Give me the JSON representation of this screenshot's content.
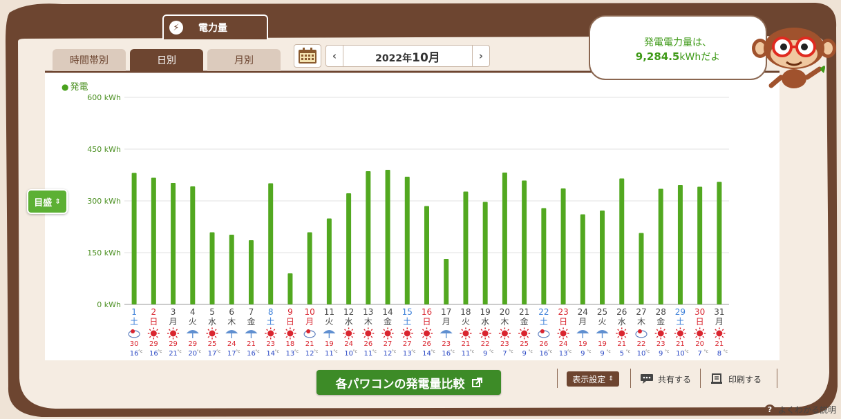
{
  "tabs": {
    "main": "電力量"
  },
  "subtabs": [
    {
      "label": "時間帯別",
      "active": false
    },
    {
      "label": "日別",
      "active": true
    },
    {
      "label": "月別",
      "active": false
    }
  ],
  "date": {
    "year": "2022年",
    "month": "10月",
    "prev": "‹",
    "next": "›"
  },
  "bubble": {
    "line1": "発電電力量は、",
    "value": "9,284.5",
    "unit": "kWh",
    "suffix": "だよ"
  },
  "legend": {
    "label": "発電"
  },
  "mokusei": {
    "label": "目盛",
    "arrows": "⇕"
  },
  "compare_button": {
    "label": "各パワコンの発電量比較",
    "icon": "external-link-icon"
  },
  "toolbar": {
    "display_settings": "表示設定",
    "share": "共有する",
    "print": "印刷する"
  },
  "help": {
    "label": "よくわかる説明"
  },
  "colors": {
    "bar": "#52a820",
    "brown": "#6d4530",
    "saturday": "#3b7fd9",
    "sunday": "#d9252f",
    "temp_high": "#d9252f",
    "temp_low": "#2a48c4"
  },
  "chart_data": {
    "type": "bar",
    "ylim": [
      0,
      600
    ],
    "yticks": [
      "0 kWh",
      "150 kWh",
      "300 kWh",
      "450 kWh",
      "600 kWh"
    ],
    "ytick_values": [
      0,
      150,
      300,
      450,
      600
    ],
    "days": [
      "1",
      "2",
      "3",
      "4",
      "5",
      "6",
      "7",
      "8",
      "9",
      "10",
      "11",
      "12",
      "13",
      "14",
      "15",
      "16",
      "17",
      "18",
      "19",
      "20",
      "21",
      "22",
      "23",
      "24",
      "25",
      "26",
      "27",
      "28",
      "29",
      "30",
      "31"
    ],
    "weekdays": [
      "土",
      "日",
      "月",
      "火",
      "水",
      "木",
      "金",
      "土",
      "日",
      "月",
      "火",
      "水",
      "木",
      "金",
      "土",
      "日",
      "月",
      "火",
      "水",
      "木",
      "金",
      "土",
      "日",
      "月",
      "火",
      "水",
      "木",
      "金",
      "土",
      "日",
      "月"
    ],
    "day_kinds": [
      "sat",
      "sun",
      "wd",
      "wd",
      "wd",
      "wd",
      "wd",
      "sat",
      "sun",
      "hol",
      "wd",
      "wd",
      "wd",
      "wd",
      "sat",
      "sun",
      "wd",
      "wd",
      "wd",
      "wd",
      "wd",
      "sat",
      "sun",
      "wd",
      "wd",
      "wd",
      "wd",
      "wd",
      "sat",
      "sun",
      "wd"
    ],
    "weather": [
      "cloudy",
      "sunny",
      "sunny",
      "rain",
      "sunny",
      "rain",
      "rain",
      "sunny",
      "sunny",
      "cloudy",
      "rain",
      "sunny",
      "sunny",
      "sunny",
      "sunny",
      "sunny",
      "rain",
      "sunny",
      "sunny",
      "sunny",
      "sunny",
      "cloudy",
      "sunny",
      "rain",
      "rain",
      "sunny",
      "cloudy",
      "sunny",
      "sunny",
      "sunny",
      "sunny"
    ],
    "temp_high": [
      "30",
      "29",
      "29",
      "29",
      "25",
      "24",
      "21",
      "23",
      "18",
      "21",
      "19",
      "24",
      "26",
      "27",
      "27",
      "26",
      "23",
      "21",
      "22",
      "23",
      "25",
      "26",
      "24",
      "19",
      "19",
      "21",
      "22",
      "23",
      "21",
      "20",
      "21"
    ],
    "temp_low": [
      "16",
      "16",
      "21",
      "20",
      "17",
      "17",
      "16",
      "14",
      "13",
      "12",
      "11",
      "10",
      "11",
      "12",
      "13",
      "14",
      "16",
      "11",
      "9",
      "7",
      "9",
      "16",
      "13",
      "9",
      "9",
      "5",
      "10",
      "9",
      "10",
      "7",
      "8"
    ],
    "temp_unit": "°c",
    "values": [
      381,
      367,
      352,
      342,
      209,
      202,
      186,
      351,
      90,
      209,
      249,
      322,
      386,
      390,
      370,
      285,
      132,
      327,
      297,
      382,
      359,
      279,
      336,
      261,
      272,
      365,
      207,
      335,
      346,
      341,
      355
    ]
  }
}
